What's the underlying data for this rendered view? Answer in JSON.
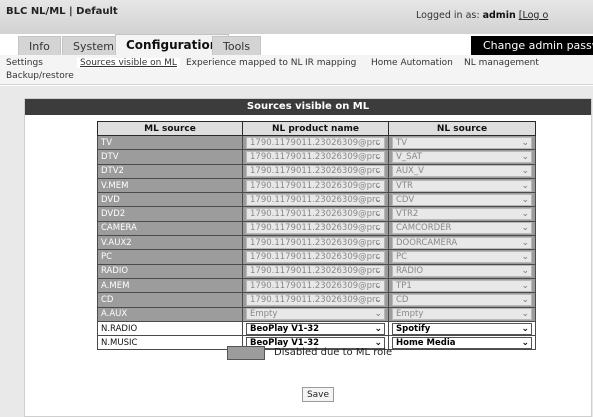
{
  "header": {
    "title": "BLC NL/ML | Default",
    "login_prefix": "Logged in as: ",
    "user": "admin",
    "logout": "[Log o"
  },
  "tabs": [
    {
      "label": "Info",
      "active": false
    },
    {
      "label": "System",
      "active": false
    },
    {
      "label": "Configuration",
      "active": true
    },
    {
      "label": "Tools",
      "active": false
    }
  ],
  "change_admin_label": "Change admin passwor",
  "subnav": [
    {
      "label": "Settings",
      "current": false
    },
    {
      "label": "Sources visible on ML",
      "current": true
    },
    {
      "label": "Experience mapped to NL",
      "current": false
    },
    {
      "label": "IR mapping",
      "current": false
    },
    {
      "label": "Home Automation",
      "current": false
    },
    {
      "label": "NL management",
      "current": false
    },
    {
      "label": "Backup/restore",
      "current": false
    }
  ],
  "panel_title": "Sources visible on ML",
  "table": {
    "columns": [
      "ML source",
      "NL product name",
      "NL source"
    ],
    "rows": [
      {
        "ml_source": "TV",
        "nl_product": "1790.1179011.23026309@prc",
        "nl_source": "TV",
        "disabled": true
      },
      {
        "ml_source": "DTV",
        "nl_product": "1790.1179011.23026309@prc",
        "nl_source": "V_SAT",
        "disabled": true
      },
      {
        "ml_source": "DTV2",
        "nl_product": "1790.1179011.23026309@prc",
        "nl_source": "AUX_V",
        "disabled": true
      },
      {
        "ml_source": "V.MEM",
        "nl_product": "1790.1179011.23026309@prc",
        "nl_source": "VTR",
        "disabled": true
      },
      {
        "ml_source": "DVD",
        "nl_product": "1790.1179011.23026309@prc",
        "nl_source": "CDV",
        "disabled": true
      },
      {
        "ml_source": "DVD2",
        "nl_product": "1790.1179011.23026309@prc",
        "nl_source": "VTR2",
        "disabled": true
      },
      {
        "ml_source": "CAMERA",
        "nl_product": "1790.1179011.23026309@prc",
        "nl_source": "CAMCORDER",
        "disabled": true
      },
      {
        "ml_source": "V.AUX2",
        "nl_product": "1790.1179011.23026309@prc",
        "nl_source": "DOORCAMERA",
        "disabled": true
      },
      {
        "ml_source": "PC",
        "nl_product": "1790.1179011.23026309@prc",
        "nl_source": "PC",
        "disabled": true
      },
      {
        "ml_source": "RADIO",
        "nl_product": "1790.1179011.23026309@prc",
        "nl_source": "RADIO",
        "disabled": true
      },
      {
        "ml_source": "A.MEM",
        "nl_product": "1790.1179011.23026309@prc",
        "nl_source": "TP1",
        "disabled": true
      },
      {
        "ml_source": "CD",
        "nl_product": "1790.1179011.23026309@prc",
        "nl_source": "CD",
        "disabled": true
      },
      {
        "ml_source": "A.AUX",
        "nl_product": "Empty",
        "nl_source": "Empty",
        "disabled": true
      },
      {
        "ml_source": "N.RADIO",
        "nl_product": "BeoPlay V1-32",
        "nl_source": "Spotify",
        "disabled": false
      },
      {
        "ml_source": "N.MUSIC",
        "nl_product": "BeoPlay V1-32",
        "nl_source": "Home Media",
        "disabled": false
      }
    ]
  },
  "legend_text": "Disabled due to ML role",
  "save_label": "Save",
  "icons": {
    "dropdown": "chevron-down-icon"
  },
  "colors": {
    "disabled_row": "#9c9c9c",
    "header_bar": "#3c3c3c",
    "admin_button": "#000000"
  }
}
